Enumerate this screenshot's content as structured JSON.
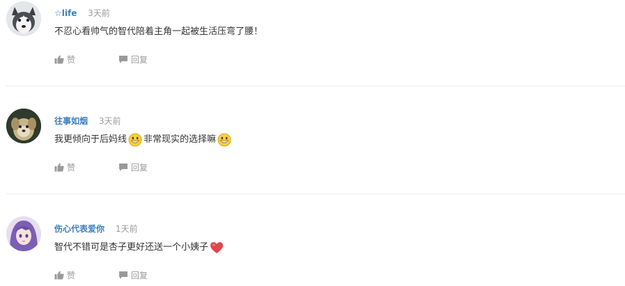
{
  "comments": [
    {
      "username": "☆life",
      "time": "3天前",
      "text_parts": [
        "不忍心看帅气的智代陪着主角一起被生活压弯了腰！"
      ],
      "like_label": "赞",
      "reply_label": "回复",
      "avatar_icon": "husky-avatar"
    },
    {
      "username": "往事如烟",
      "time": "3天前",
      "text_parts": [
        "我更倾向于后妈线",
        "非常现实的选择嘛"
      ],
      "like_label": "赞",
      "reply_label": "回复",
      "avatar_icon": "puppy-avatar"
    },
    {
      "username": "伤心代表爱你",
      "time": "1天前",
      "text_parts": [
        "智代不错可是杏子更好还送一个小姨子"
      ],
      "like_label": "赞",
      "reply_label": "回复",
      "avatar_icon": "anime-girl-avatar"
    }
  ],
  "colors": {
    "username": "#3a7fc1",
    "meta": "#9a9a9a",
    "text": "#333333",
    "heart": "#e0474c",
    "smiley": "#f7d13d"
  }
}
